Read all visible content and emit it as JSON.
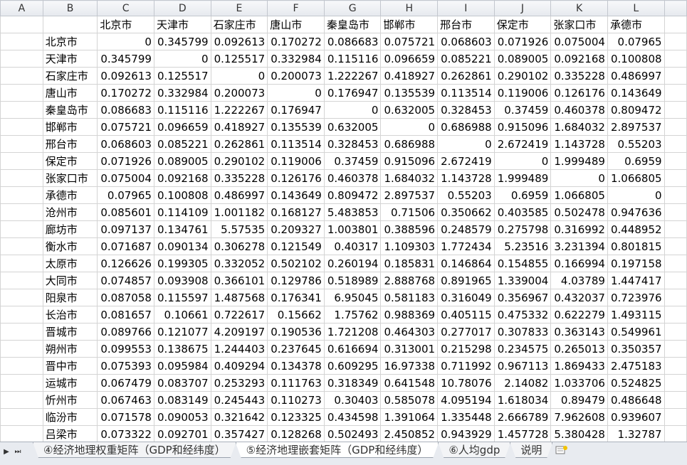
{
  "columns": [
    "A",
    "B",
    "C",
    "D",
    "E",
    "F",
    "G",
    "H",
    "I",
    "J",
    "K",
    "L"
  ],
  "header_row": [
    "",
    "",
    "北京市",
    "天津市",
    "石家庄市",
    "唐山市",
    "秦皇岛市",
    "邯郸市",
    "邢台市",
    "保定市",
    "张家口市",
    "承德市"
  ],
  "rows": [
    [
      "北京市",
      "0",
      "0.345799",
      "0.092613",
      "0.170272",
      "0.086683",
      "0.075721",
      "0.068603",
      "0.071926",
      "0.075004",
      "0.07965"
    ],
    [
      "天津市",
      "0.345799",
      "0",
      "0.125517",
      "0.332984",
      "0.115116",
      "0.096659",
      "0.085221",
      "0.089005",
      "0.092168",
      "0.100808"
    ],
    [
      "石家庄市",
      "0.092613",
      "0.125517",
      "0",
      "0.200073",
      "1.222267",
      "0.418927",
      "0.262861",
      "0.290102",
      "0.335228",
      "0.486997"
    ],
    [
      "唐山市",
      "0.170272",
      "0.332984",
      "0.200073",
      "0",
      "0.176947",
      "0.135539",
      "0.113514",
      "0.119006",
      "0.126176",
      "0.143649"
    ],
    [
      "秦皇岛市",
      "0.086683",
      "0.115116",
      "1.222267",
      "0.176947",
      "0",
      "0.632005",
      "0.328453",
      "0.37459",
      "0.460378",
      "0.809472"
    ],
    [
      "邯郸市",
      "0.075721",
      "0.096659",
      "0.418927",
      "0.135539",
      "0.632005",
      "0",
      "0.686988",
      "0.915096",
      "1.684032",
      "2.897537"
    ],
    [
      "邢台市",
      "0.068603",
      "0.085221",
      "0.262861",
      "0.113514",
      "0.328453",
      "0.686988",
      "0",
      "2.672419",
      "1.143728",
      "0.55203"
    ],
    [
      "保定市",
      "0.071926",
      "0.089005",
      "0.290102",
      "0.119006",
      "0.37459",
      "0.915096",
      "2.672419",
      "0",
      "1.999489",
      "0.6959"
    ],
    [
      "张家口市",
      "0.075004",
      "0.092168",
      "0.335228",
      "0.126176",
      "0.460378",
      "1.684032",
      "1.143728",
      "1.999489",
      "0",
      "1.066805"
    ],
    [
      "承德市",
      "0.07965",
      "0.100808",
      "0.486997",
      "0.143649",
      "0.809472",
      "2.897537",
      "0.55203",
      "0.6959",
      "1.066805",
      "0"
    ],
    [
      "沧州市",
      "0.085601",
      "0.114109",
      "1.001182",
      "0.168127",
      "5.483853",
      "0.71506",
      "0.350662",
      "0.403585",
      "0.502478",
      "0.947636"
    ],
    [
      "廊坊市",
      "0.097137",
      "0.134761",
      "5.57535",
      "0.209327",
      "1.003801",
      "0.388596",
      "0.248579",
      "0.275798",
      "0.316992",
      "0.448952"
    ],
    [
      "衡水市",
      "0.071687",
      "0.090134",
      "0.306278",
      "0.121549",
      "0.40317",
      "1.109303",
      "1.772434",
      "5.23516",
      "3.231394",
      "0.801815"
    ],
    [
      "太原市",
      "0.126626",
      "0.199305",
      "0.332052",
      "0.502102",
      "0.260194",
      "0.185831",
      "0.146864",
      "0.154855",
      "0.166994",
      "0.197158"
    ],
    [
      "大同市",
      "0.074857",
      "0.093908",
      "0.366101",
      "0.129786",
      "0.518989",
      "2.888768",
      "0.891965",
      "1.339004",
      "4.03789",
      "1.447417"
    ],
    [
      "阳泉市",
      "0.087058",
      "0.115597",
      "1.487568",
      "0.176341",
      "6.95045",
      "0.581183",
      "0.316049",
      "0.356967",
      "0.432037",
      "0.723976"
    ],
    [
      "长治市",
      "0.081657",
      "0.10661",
      "0.722617",
      "0.15662",
      "1.75762",
      "0.988369",
      "0.405115",
      "0.475332",
      "0.622279",
      "1.493115"
    ],
    [
      "晋城市",
      "0.089766",
      "0.121077",
      "4.209197",
      "0.190536",
      "1.721208",
      "0.464303",
      "0.277017",
      "0.307833",
      "0.363143",
      "0.549961"
    ],
    [
      "朔州市",
      "0.099553",
      "0.138675",
      "1.244403",
      "0.237645",
      "0.616694",
      "0.313001",
      "0.215298",
      "0.234575",
      "0.265013",
      "0.350357"
    ],
    [
      "晋中市",
      "0.075393",
      "0.095984",
      "0.409294",
      "0.134378",
      "0.609295",
      "16.97338",
      "0.711992",
      "0.967113",
      "1.869433",
      "2.475183"
    ],
    [
      "运城市",
      "0.067479",
      "0.083707",
      "0.253293",
      "0.111763",
      "0.318349",
      "0.641548",
      "10.78076",
      "2.14082",
      "1.033706",
      "0.524825"
    ],
    [
      "忻州市",
      "0.067463",
      "0.083149",
      "0.245443",
      "0.110273",
      "0.30403",
      "0.585078",
      "4.095194",
      "1.618034",
      "0.89479",
      "0.486648"
    ],
    [
      "临汾市",
      "0.071578",
      "0.090053",
      "0.321642",
      "0.123325",
      "0.434598",
      "1.391064",
      "1.335448",
      "2.666789",
      "7.962608",
      "0.939607"
    ],
    [
      "吕梁市",
      "0.073322",
      "0.092701",
      "0.357427",
      "0.128268",
      "0.502493",
      "2.450852",
      "0.943929",
      "1.457728",
      "5.380428",
      "1.32787"
    ]
  ],
  "tabs": [
    {
      "label": "④经济地理权重矩阵（GDP和经纬度）",
      "active": false
    },
    {
      "label": "⑤经济地理嵌套矩阵（GDP和经纬度）",
      "active": true
    },
    {
      "label": "⑥人均gdp",
      "active": false
    },
    {
      "label": "说明",
      "active": false
    }
  ],
  "nav": {
    "first": "⏮",
    "next": "▶",
    "last": "⏭"
  },
  "icons": {
    "new_sheet": "new-sheet-icon"
  }
}
